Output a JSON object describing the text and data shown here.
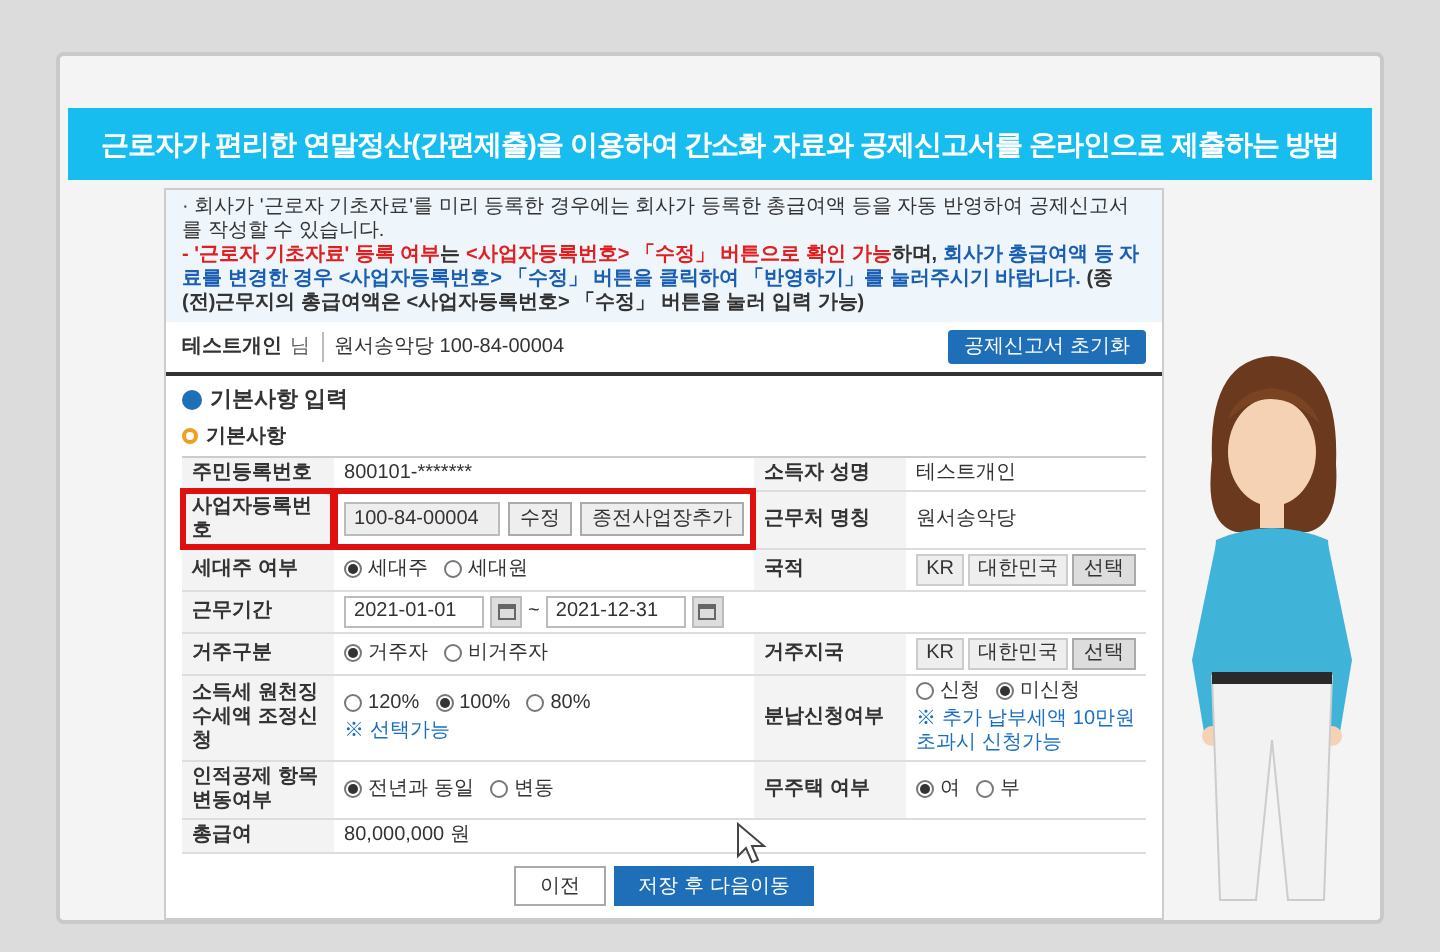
{
  "title": "근로자가 편리한 연말정산(간편제출)을 이용하여 간소화 자료와 공제신고서를 온라인으로 제출하는 방법",
  "notice": [
    {
      "segments": [
        {
          "text": "· 회사가 '근로자 기초자료'를 미리 등록한 경우에는 회사가 등록한 총급여액 등을 자동 반영하여 공제신고서를 작성할 수 있습니다.",
          "color": "#333333"
        }
      ]
    },
    {
      "segments": [
        {
          "text": "- '근로자 기초자료' 등록 여부",
          "color": "#e02020"
        },
        {
          "text": "는 ",
          "color": "#333333"
        },
        {
          "text": "<사업자등록번호> 「수정」 버튼으로 확인 가능",
          "color": "#e02020"
        },
        {
          "text": "하며, ",
          "color": "#333333"
        },
        {
          "text": "회사가 총급여액 등 자료를 변경한 경우 <사업자등록번호> 「수정」 버튼을 클릭하여 「반영하기」를 눌러주시기 바랍니다.",
          "color": "#1a5fb4"
        },
        {
          "text": " (종(전)근무지의 총급여액은 <사업자등록번호> 「수정」 버튼을 눌러 입력 가능)",
          "color": "#333333"
        }
      ]
    }
  ],
  "user": {
    "name": "테스트개인",
    "honorific": "님",
    "company": "원서송악당 100-84-00004",
    "reset_button": "공제신고서 초기화"
  },
  "section": "기본사항 입력",
  "subsection": "기본사항",
  "rows": [
    {
      "fields": [
        {
          "label": "주민등록번호",
          "kind": "text",
          "highlighted": false,
          "value": "800101-*******"
        },
        {
          "label": "소득자 성명",
          "kind": "text",
          "highlighted": false,
          "value": "테스트개인"
        }
      ]
    },
    {
      "fields": [
        {
          "label": "사업자등록번호",
          "kind": "input",
          "highlighted": true,
          "value": "100-84-00004",
          "buttons": [
            "수정",
            "종전사업장추가"
          ]
        },
        {
          "label": "근무처 명칭",
          "kind": "text",
          "highlighted": false,
          "value": "원서송악당"
        }
      ]
    },
    {
      "fields": [
        {
          "label": "세대주 여부",
          "kind": "radio",
          "highlighted": false,
          "options": [
            {
              "label": "세대주",
              "selected": true
            },
            {
              "label": "세대원",
              "selected": false
            }
          ]
        },
        {
          "label": "국적",
          "kind": "country",
          "highlighted": false,
          "code": "KR",
          "name": "대한민국",
          "button": "선택"
        }
      ]
    },
    {
      "fields": [
        {
          "label": "근무기간",
          "kind": "period",
          "highlighted": false,
          "start": "2021-01-01",
          "separator": "~",
          "end": "2021-12-31"
        }
      ]
    },
    {
      "fields": [
        {
          "label": "거주구분",
          "kind": "radio",
          "highlighted": false,
          "options": [
            {
              "label": "거주자",
              "selected": true
            },
            {
              "label": "비거주자",
              "selected": false
            }
          ]
        },
        {
          "label": "거주지국",
          "kind": "country",
          "highlighted": false,
          "code": "KR",
          "name": "대한민국",
          "button": "선택"
        }
      ]
    },
    {
      "fields": [
        {
          "label": "소득세 원천징수세액 조정신청",
          "kind": "radio",
          "highlighted": false,
          "options": [
            {
              "label": "120%",
              "selected": false
            },
            {
              "label": "100%",
              "selected": true
            },
            {
              "label": "80%",
              "selected": false
            }
          ],
          "note": "※ 선택가능"
        },
        {
          "label": "분납신청여부",
          "kind": "radio",
          "highlighted": false,
          "options": [
            {
              "label": "신청",
              "selected": false
            },
            {
              "label": "미신청",
              "selected": true
            }
          ],
          "note": "※ 추가 납부세액 10만원 초과시 신청가능"
        }
      ]
    },
    {
      "fields": [
        {
          "label": "인적공제 항목 변동여부",
          "kind": "radio",
          "highlighted": false,
          "options": [
            {
              "label": "전년과 동일",
              "selected": true
            },
            {
              "label": "변동",
              "selected": false
            }
          ]
        },
        {
          "label": "무주택 여부",
          "kind": "radio",
          "highlighted": false,
          "options": [
            {
              "label": "여",
              "selected": true
            },
            {
              "label": "부",
              "selected": false
            }
          ]
        }
      ]
    },
    {
      "fields": [
        {
          "label": "총급여",
          "kind": "text",
          "highlighted": false,
          "value": "80,000,000 원"
        }
      ]
    }
  ],
  "buttons": [
    {
      "label": "이전",
      "kind": "secondary"
    },
    {
      "label": "저장 후 다음이동",
      "kind": "primary"
    }
  ]
}
